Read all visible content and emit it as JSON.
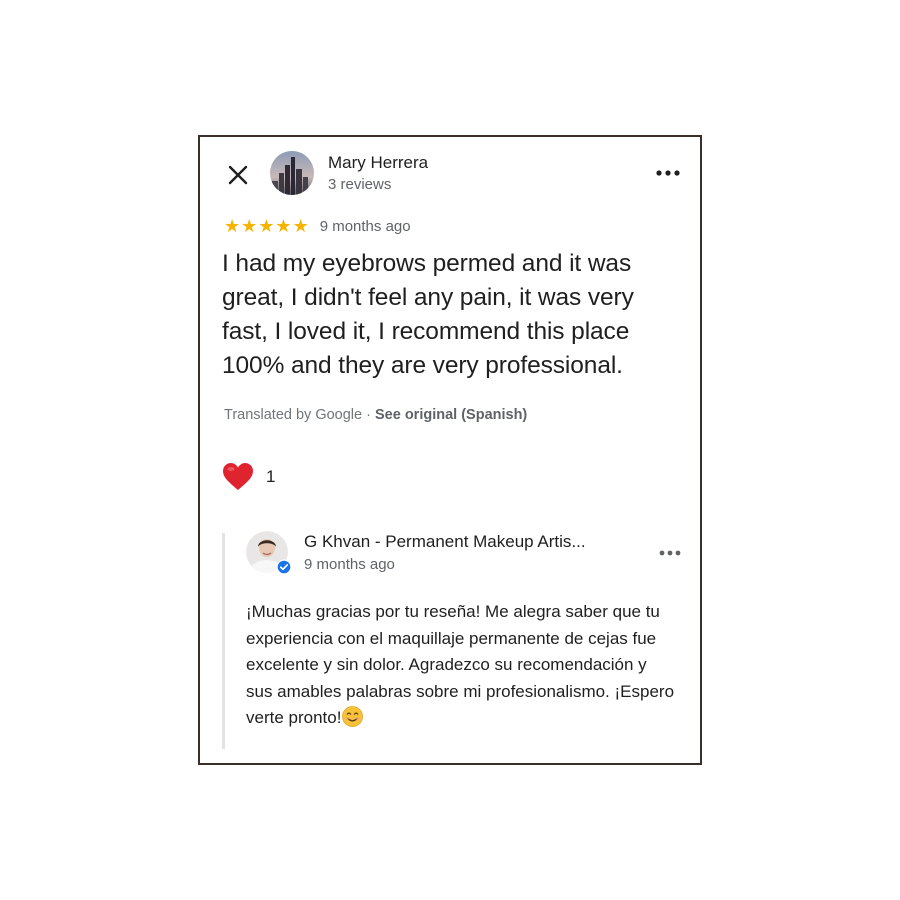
{
  "review": {
    "reviewer_name": "Mary Herrera",
    "reviewer_meta": "3 reviews",
    "rating": 5,
    "time": "9 months ago",
    "text": "I had my eyebrows permed and it was great, I didn't feel any pain, it was very fast, I loved it, I recommend this place 100% and they are very professional.",
    "translated_prefix": "Translated by Google · ",
    "see_original": "See original (Spanish)",
    "reaction_count": "1"
  },
  "owner_response": {
    "name": "G Khvan - Permanent Makeup Artis...",
    "time": "9 months ago",
    "text": "¡Muchas gracias por tu reseña! Me alegra saber que tu experiencia con el maquillaje permanente de cejas fue excelente y sin dolor. Agradezco su recomendación y sus amables palabras sobre mi profesionalismo. ¡Espero verte pronto!"
  },
  "icons": {
    "close": "close-icon",
    "more": "more-horizontal-icon",
    "star": "star-icon",
    "heart": "heart-icon",
    "verified": "verified-badge-icon",
    "smile": "smiling-face-emoji"
  },
  "colors": {
    "star": "#f6b400",
    "heart": "#e0242f",
    "verified": "#1a73e8",
    "card_border": "#3b2f2c",
    "secondary_text": "#5f6368"
  }
}
